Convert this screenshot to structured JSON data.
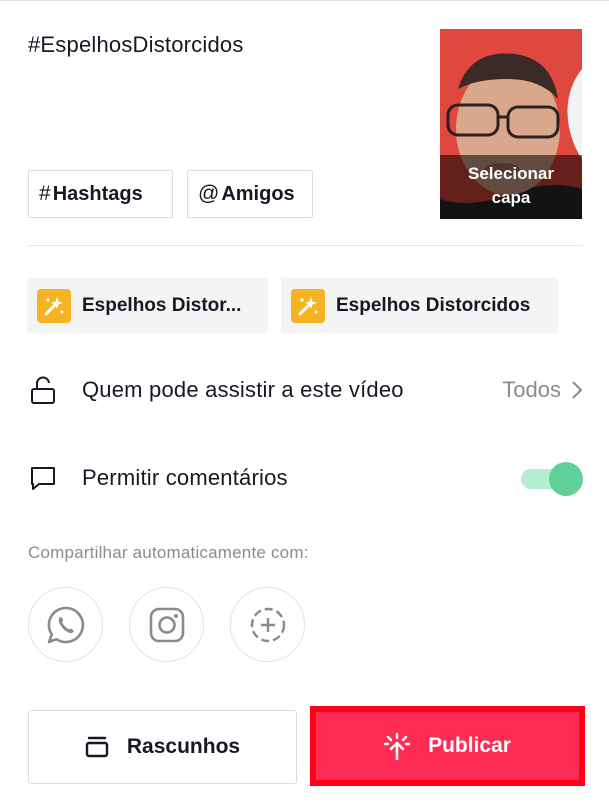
{
  "post": {
    "caption": "#EspelhosDistorcidos",
    "cover_label_line1": "Selecionar",
    "cover_label_line2": "capa"
  },
  "chips": {
    "hashtags_symbol": "#",
    "hashtags_label": "Hashtags",
    "amigos_symbol": "@",
    "amigos_label": "Amigos"
  },
  "effects": [
    {
      "label": "Espelhos Distor...",
      "icon": "sparkle-effect-icon"
    },
    {
      "label": "Espelhos Distorcidos",
      "icon": "sparkle-effect-icon"
    }
  ],
  "settings": {
    "privacy_label": "Quem pode assistir a este vídeo",
    "privacy_value": "Todos",
    "comments_label": "Permitir comentários",
    "comments_enabled": true
  },
  "share": {
    "label": "Compartilhar automaticamente com:",
    "targets": [
      "whatsapp-icon",
      "instagram-icon",
      "add-share-icon"
    ]
  },
  "actions": {
    "drafts_label": "Rascunhos",
    "publish_label": "Publicar"
  },
  "colors": {
    "accent": "#fe2c55",
    "highlight_border": "#ff0016",
    "toggle_on": "#5fd09a",
    "effect_icon_bg": "#f6b324"
  }
}
